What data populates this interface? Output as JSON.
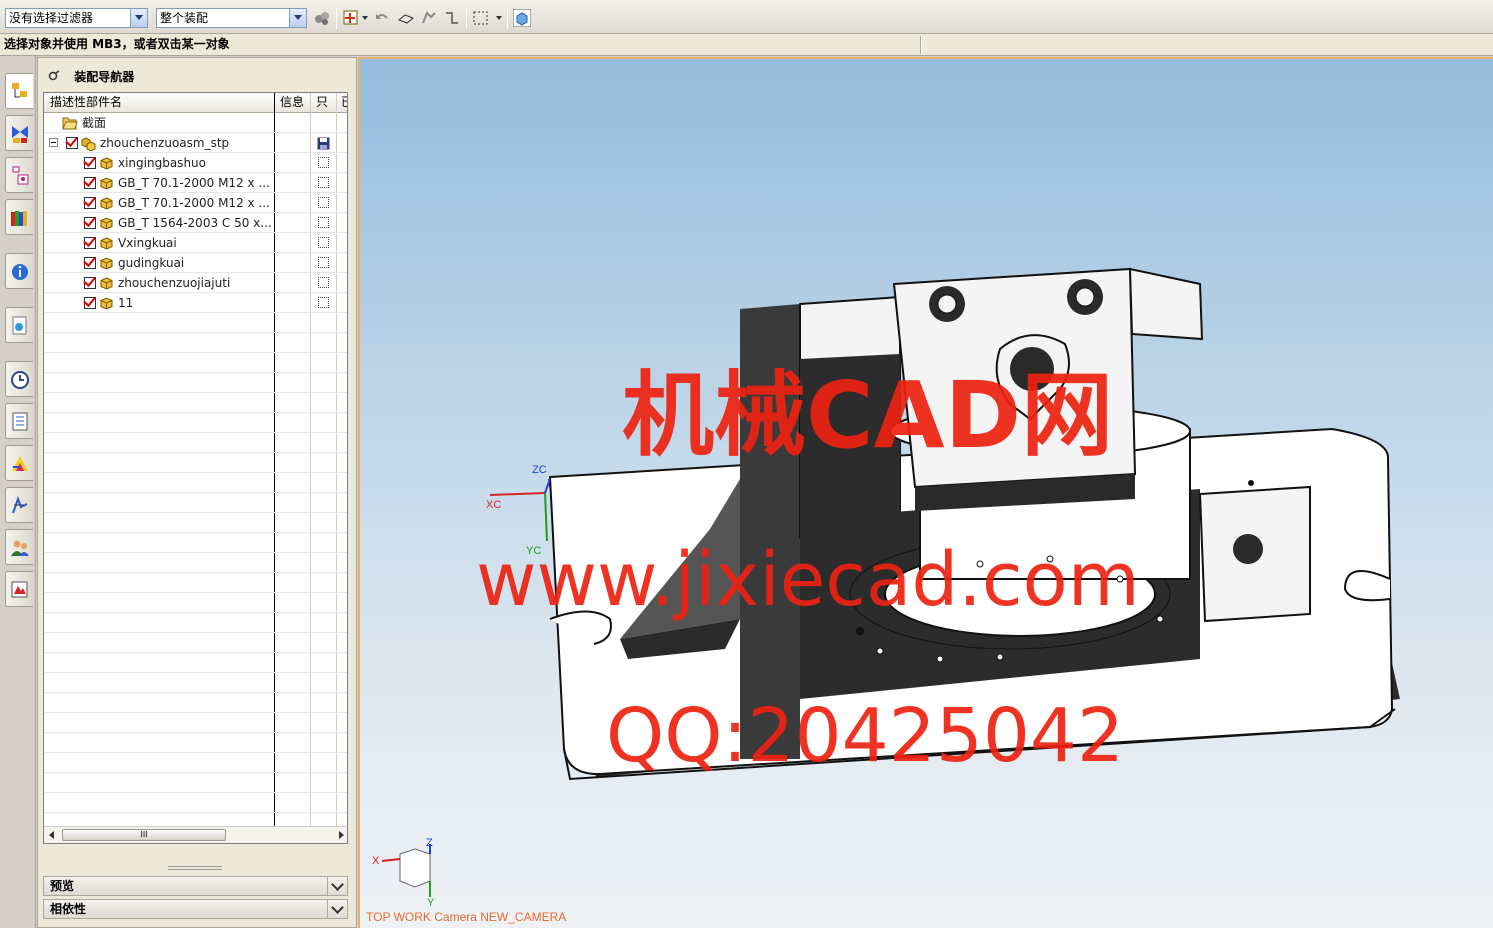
{
  "toolbar": {
    "filter_select": "没有选择过滤器",
    "scope_select": "整个装配"
  },
  "status": {
    "prompt": "选择对象并使用 MB3，或者双击某一对象"
  },
  "navigator": {
    "title": "装配导航器",
    "columns": {
      "name": "描述性部件名",
      "info": "信息",
      "readonly": "只",
      "extra": "已"
    },
    "section_node": "截面",
    "root": "zhouchenzuoasm_stp",
    "parts": [
      "xingingbashuo",
      "GB_T 70.1-2000 M12 x ...",
      "GB_T 70.1-2000 M12 x ...",
      "GB_T 1564-2003 C 50 x...",
      "Vxingkuai",
      "gudingkuai",
      "zhouchenzuojiajuti",
      "11"
    ],
    "scroll_thumb": "III",
    "panels": {
      "preview": "预览",
      "dependency": "相依性"
    }
  },
  "viewport": {
    "camera_label": "TOP WORK Camera NEW_CAMERA",
    "wcs": {
      "x": "XC",
      "y": "YC",
      "z": "ZC"
    },
    "triad": {
      "x": "X",
      "y": "Y",
      "z": "Z"
    },
    "watermark": {
      "line1": "机械CAD网",
      "line2": "www.jixiecad.com",
      "line3": "QQ:20425042"
    }
  }
}
